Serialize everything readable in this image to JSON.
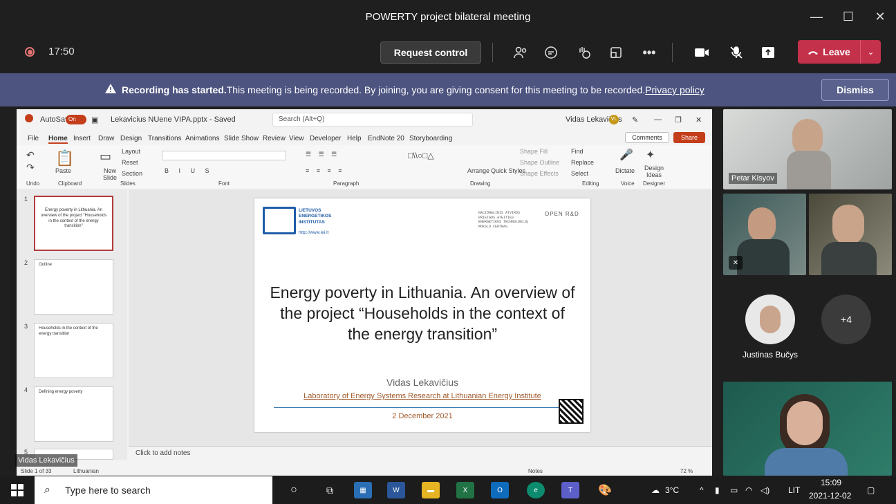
{
  "window": {
    "title": "POWERTY project bilateral meeting",
    "minimize": "—",
    "maximize": "☐",
    "close": "✕"
  },
  "toolbar": {
    "timer": "17:50",
    "request_control": "Request control",
    "more": "•••",
    "leave": "Leave"
  },
  "banner": {
    "bold": "Recording has started.",
    "text": " This meeting is being recorded. By joining, you are giving consent for this meeting to be recorded.",
    "link": "Privacy policy",
    "dismiss": "Dismiss"
  },
  "ppt": {
    "autosave": "AutoSave",
    "autosave_state": "On",
    "filename": "Lekavicius NUene VIPA.pptx - Saved",
    "search": "Search (Alt+Q)",
    "user": "Vidas Lekavičius",
    "user_initials": "VL",
    "menu": [
      "File",
      "Home",
      "Insert",
      "Draw",
      "Design",
      "Transitions",
      "Animations",
      "Slide Show",
      "Review",
      "View",
      "Developer",
      "Help",
      "EndNote 20",
      "Storyboarding"
    ],
    "comments": "Comments",
    "share": "Share",
    "ribbon_groups": [
      "Undo",
      "Clipboard",
      "Slides",
      "Font",
      "Paragraph",
      "Drawing",
      "Editing",
      "Voice",
      "Designer"
    ],
    "ribbon_items": {
      "paste": "Paste",
      "new_slide": "New Slide",
      "layout": "Layout",
      "reset": "Reset",
      "section": "Section",
      "arrange": "Arrange",
      "quick_styles": "Quick Styles",
      "shape_fill": "Shape Fill",
      "shape_outline": "Shape Outline",
      "shape_effects": "Shape Effects",
      "find": "Find",
      "replace": "Replace",
      "select": "Select",
      "dictate": "Dictate",
      "design_ideas": "Design Ideas"
    },
    "thumbs": [
      {
        "num": "1",
        "text": "Energy poverty in Lithuania. An overview of the project \"Households in the context of the energy transition\""
      },
      {
        "num": "2",
        "text": "Outline"
      },
      {
        "num": "3",
        "text": "Households in the context of the energy transition"
      },
      {
        "num": "4",
        "text": "Defining energy poverty"
      },
      {
        "num": "5",
        "text": ""
      }
    ],
    "slide": {
      "main_title": "Energy poverty in Lithuania. An overview of the project “Households in the context of the energy transition”",
      "author": "Vidas Lekavičius",
      "lab": "Laboratory of Energy Systems Research at Lithuanian Energy Institute",
      "date": "2 December 2021",
      "lei_text": "LIETUVOS\nENERGETIKOS\nINSTITUTAS",
      "lei_url": "http://www.lei.lt",
      "open_rd_text": "NACIONALINIS ATVIROS\nPRIEIGOS ATEITIES\nENERGETIKOS TECHNOLOGIJŲ\nMOKSLO CENTRAS",
      "open_logo": "OPEN R&D"
    },
    "notes": "Click to add notes",
    "status_left": "Slide 1 of 33",
    "status_lang": "Lithuanian",
    "status_notes": "Notes",
    "zoom": "72 %"
  },
  "presenter_name": "Vidas Lekavičius",
  "participants": [
    {
      "name": "Petar Kisyov"
    },
    {
      "name": "Justinas Bučys"
    }
  ],
  "more_participants": "+4",
  "taskbar": {
    "search": "Type here to search",
    "temperature": "3°C",
    "lang": "LIT",
    "time": "15:09",
    "date": "2021-12-02"
  }
}
